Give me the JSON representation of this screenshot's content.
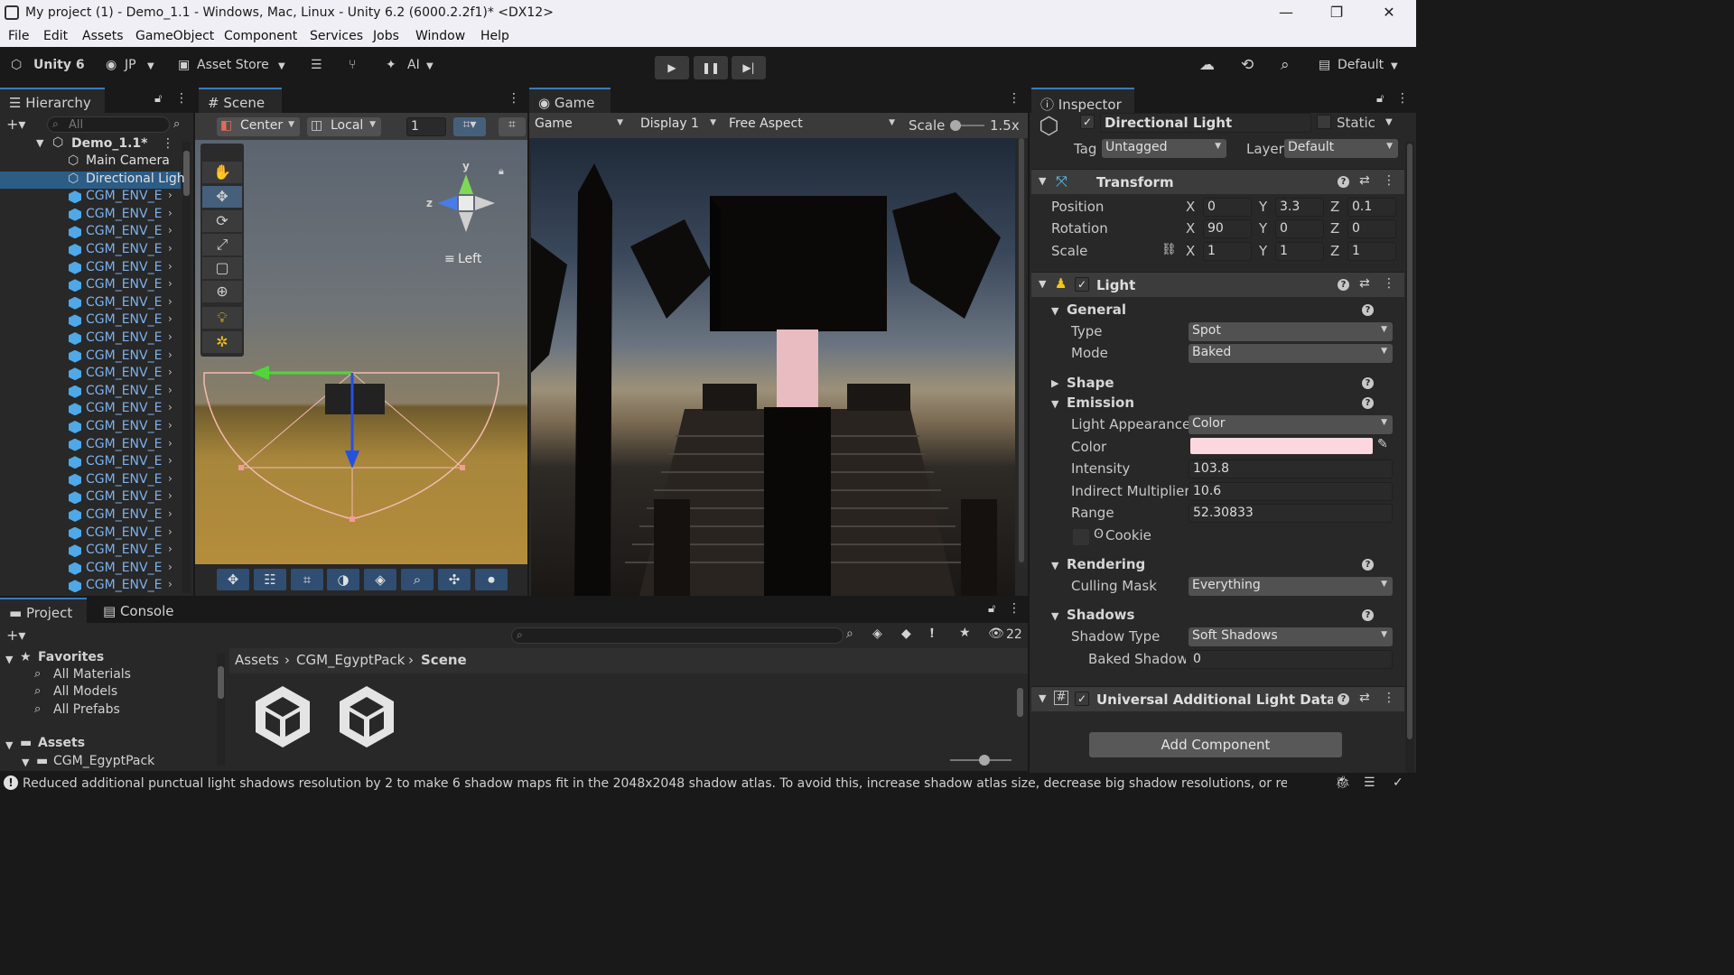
{
  "window": {
    "title": "My project (1) - Demo_1.1 - Windows, Mac, Linux - Unity 6.2 (6000.2.2f1)* <DX12>",
    "minimize_glyph": "—",
    "maximize_glyph": "❐",
    "close_glyph": "✕"
  },
  "menu": [
    "File",
    "Edit",
    "Assets",
    "GameObject",
    "Component",
    "Services",
    "Jobs",
    "Window",
    "Help"
  ],
  "toolbar": {
    "unity_label": "Unity 6",
    "account_label": "JP",
    "asset_store_label": "Asset Store",
    "ai_label": "AI",
    "layout_label": "Default"
  },
  "hierarchy": {
    "tab_label": "Hierarchy",
    "search_placeholder": "All",
    "scene_name": "Demo_1.1*",
    "items": [
      {
        "label": "Main Camera"
      },
      {
        "label": "Directional Ligh"
      },
      {
        "label": "CGM_ENV_E"
      },
      {
        "label": "CGM_ENV_E"
      },
      {
        "label": "CGM_ENV_E"
      },
      {
        "label": "CGM_ENV_E"
      },
      {
        "label": "CGM_ENV_E"
      },
      {
        "label": "CGM_ENV_E"
      },
      {
        "label": "CGM_ENV_E"
      },
      {
        "label": "CGM_ENV_E"
      },
      {
        "label": "CGM_ENV_E"
      },
      {
        "label": "CGM_ENV_E"
      },
      {
        "label": "CGM_ENV_E"
      },
      {
        "label": "CGM_ENV_E"
      },
      {
        "label": "CGM_ENV_E"
      },
      {
        "label": "CGM_ENV_E"
      },
      {
        "label": "CGM_ENV_E"
      },
      {
        "label": "CGM_ENV_E"
      },
      {
        "label": "CGM_ENV_E"
      },
      {
        "label": "CGM_ENV_E"
      },
      {
        "label": "CGM_ENV_E"
      },
      {
        "label": "CGM_ENV_E"
      },
      {
        "label": "CGM_ENV_E"
      },
      {
        "label": "CGM_ENV_E"
      },
      {
        "label": "CGM_ENV_E"
      }
    ]
  },
  "scene": {
    "tab_label": "Scene",
    "pivot_label": "Center",
    "space_label": "Local",
    "grid_value": "1",
    "gizmo_view_label": "Left",
    "gizmo_axes": {
      "y": "y",
      "z": "z"
    }
  },
  "game": {
    "tab_label": "Game",
    "mode_label": "Game",
    "display_label": "Display 1",
    "aspect_label": "Free Aspect",
    "scale_label": "Scale",
    "scale_value": "1.5x"
  },
  "inspector": {
    "tab_label": "Inspector",
    "object_name": "Directional Light",
    "static_label": "Static",
    "tag_label": "Tag",
    "tag_value": "Untagged",
    "layer_label": "Layer",
    "layer_value": "Default",
    "transform": {
      "title": "Transform",
      "rows": [
        {
          "label": "Position",
          "x": "0",
          "y": "3.3",
          "z": "0.1"
        },
        {
          "label": "Rotation",
          "x": "90",
          "y": "0",
          "z": "0"
        },
        {
          "label": "Scale",
          "x": "1",
          "y": "1",
          "z": "1"
        }
      ],
      "axis_x": "X",
      "axis_y": "Y",
      "axis_z": "Z"
    },
    "light": {
      "title": "Light",
      "general": "General",
      "type_label": "Type",
      "type_value": "Spot",
      "mode_label": "Mode",
      "mode_value": "Baked",
      "shape": "Shape",
      "emission": "Emission",
      "appearance_label": "Light Appearance",
      "appearance_value": "Color",
      "color_label": "Color",
      "color_value": "#fcd7df",
      "intensity_label": "Intensity",
      "intensity_value": "103.8",
      "indirect_label": "Indirect Multiplier",
      "indirect_value": "10.6",
      "range_label": "Range",
      "range_value": "52.30833",
      "cookie_label": "Cookie",
      "rendering": "Rendering",
      "culling_label": "Culling Mask",
      "culling_value": "Everything",
      "shadows": "Shadows",
      "shadow_type_label": "Shadow Type",
      "shadow_type_value": "Soft Shadows",
      "baked_shadow_label": "Baked Shadow I",
      "baked_shadow_value": "0"
    },
    "urp_title": "Universal Additional Light Data (Scrip",
    "add_component_label": "Add Component"
  },
  "project": {
    "tab_label": "Project",
    "console_label": "Console",
    "hidden_count": "22",
    "favorites_label": "Favorites",
    "favorites": [
      "All Materials",
      "All Models",
      "All Prefabs"
    ],
    "assets_label": "Assets",
    "assets_children": [
      "CGM_EgyptPack"
    ],
    "breadcrumb": [
      "Assets",
      "CGM_EgyptPack",
      "Scene"
    ]
  },
  "status": {
    "message": "Reduced additional punctual light shadows resolution by 2 to make 6 shadow maps fit in the 2048x2048 shadow atlas. To avoid this, increase shadow atlas size, decrease big shadow resolutions, or redu"
  },
  "colors": {
    "accent": "#3a79bb",
    "selection": "#2c5d87",
    "hierarchy_blue": "#7cb1ec"
  }
}
